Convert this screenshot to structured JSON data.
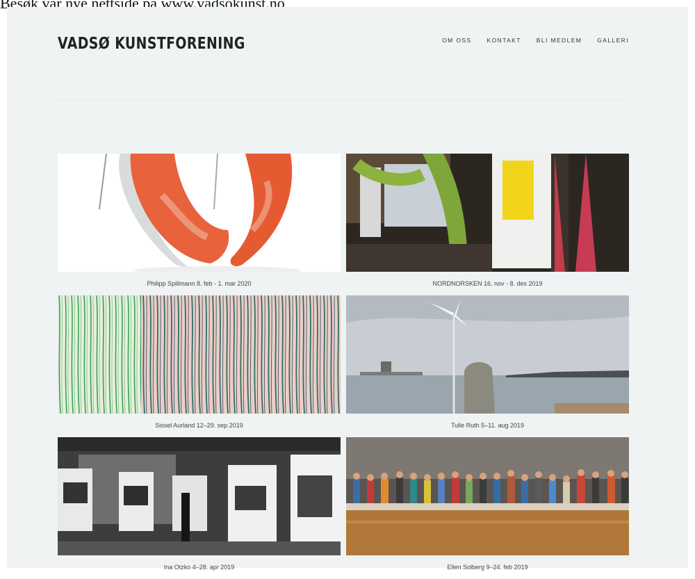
{
  "banner": {
    "text": "Besøk vår nye nettside på www.vadsokunst.no"
  },
  "site": {
    "title": "VADSØ KUNSTFORENING",
    "nav": [
      "OM OSS",
      "KONTAKT",
      "BLI MEDLEM",
      "GALLERI"
    ]
  },
  "gallery": [
    {
      "caption": "Philipp Spillmann 8. feb - 1. mar 2020"
    },
    {
      "caption": "NORDNORSKEN 16. nov - 8. des 2019"
    },
    {
      "caption": "Sissel Aurland 12–29. sep 2019"
    },
    {
      "caption": "Tulle Ruth 5–11. aug 2019"
    },
    {
      "caption": "Ina Otzko 4–28. apr 2019"
    },
    {
      "caption": "Ellen Solberg 9–24. feb 2019"
    }
  ]
}
